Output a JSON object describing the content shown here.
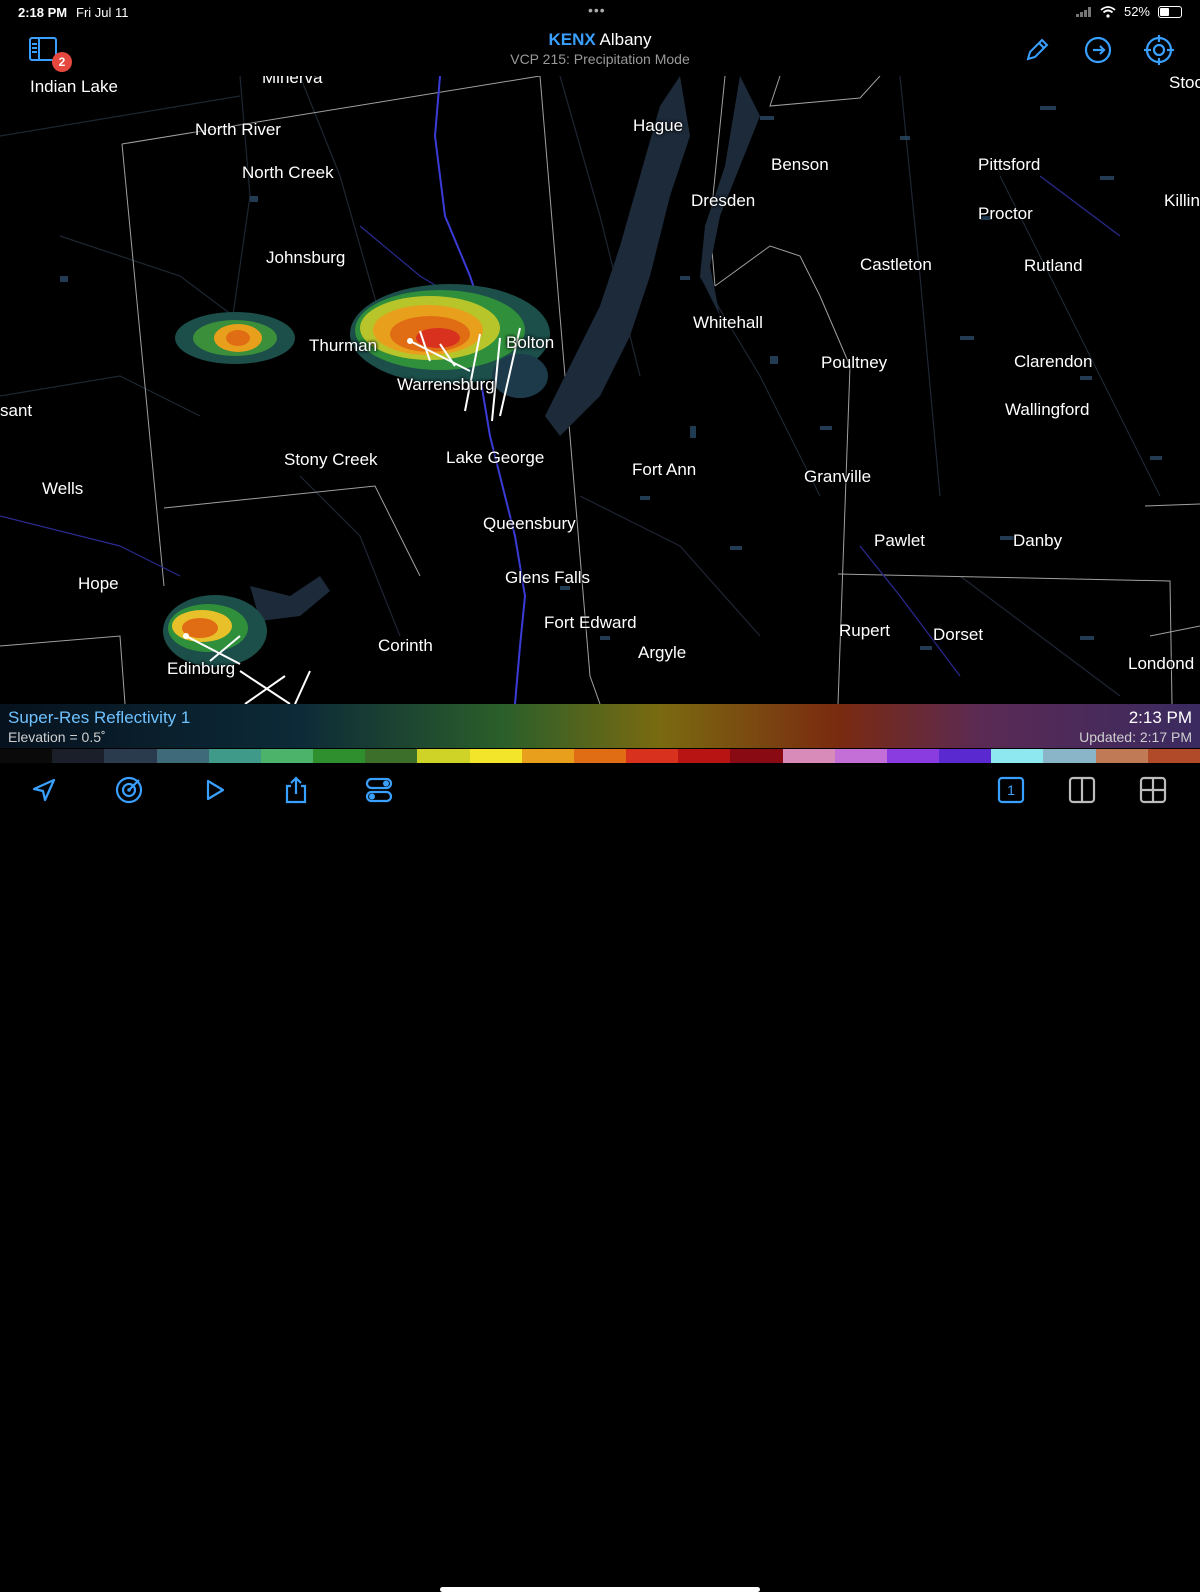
{
  "status_bar": {
    "time": "2:18 PM",
    "date": "Fri Jul 11",
    "battery": "52%",
    "battery_level": 0.52
  },
  "header": {
    "station_id": "KENX",
    "station_name": "Albany",
    "mode": "VCP 215: Precipitation Mode",
    "notifications_count": "2",
    "icons": [
      "sidebar-book-icon",
      "pencil-icon",
      "loop-icon",
      "crosshair-icon"
    ]
  },
  "map": {
    "cities": [
      "Minerva",
      "Indian Lake",
      "North River",
      "North Creek",
      "Johnsburg",
      "Thurman",
      "Warrensburg",
      "Bolton",
      "Stony Creek",
      "Lake George",
      "Queensbury",
      "Glens Falls",
      "Fort Edward",
      "Argyle",
      "Corinth",
      "Edinburg",
      "Hope",
      "Wells",
      "sant",
      "Hague",
      "Dresden",
      "Benson",
      "Pittsford",
      "Proctor",
      "Killin",
      "Stoc",
      "Castleton",
      "Rutland",
      "Whitehall",
      "Poultney",
      "Clarendon",
      "Wallingford",
      "Fort Ann",
      "Granville",
      "Pawlet",
      "Danby",
      "Rupert",
      "Dorset",
      "Londond"
    ]
  },
  "product": {
    "name": "Super-Res Reflectivity 1",
    "elevation": "Elevation = 0.5˚",
    "scan_time": "2:13 PM",
    "updated": "Updated: 2:17 PM"
  },
  "colors": {
    "accent": "#3aa0ff",
    "badge": "#e5483f",
    "scale": [
      "#0a0a0a",
      "#1a1f2a",
      "#2b3b4e",
      "#3f6a7a",
      "#3f9a8a",
      "#4cb36a",
      "#2f8f2f",
      "#3c6f2a",
      "#cfd327",
      "#f2e52a",
      "#e8a01c",
      "#e06d14",
      "#d8321e",
      "#b81414",
      "#8a0a14",
      "#d88ab8",
      "#c46fd8",
      "#8a3ce0",
      "#5a2ad0",
      "#8de8f0",
      "#8ab4c8",
      "#c07a55",
      "#b04a28"
    ]
  },
  "toolbar": {
    "icons": [
      "location-arrow-icon",
      "radar-target-icon",
      "play-icon",
      "share-icon",
      "layers-toggle-icon",
      "single-pane-icon",
      "split-pane-icon",
      "quad-pane-icon"
    ],
    "single_pane_label": "1"
  }
}
